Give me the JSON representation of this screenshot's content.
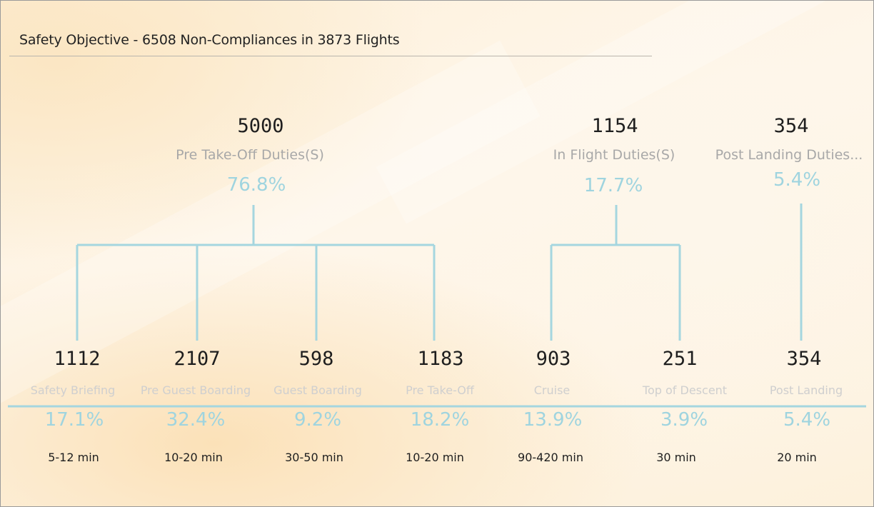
{
  "title": "Safety Objective - 6508 Non-Compliances in 3873 Flights",
  "groups": [
    {
      "value": "5000",
      "label": "Pre Take-Off Duties(S)",
      "percent": "76.8%"
    },
    {
      "value": "1154",
      "label": "In Flight Duties(S)",
      "percent": "17.7%"
    },
    {
      "value": "354",
      "label": "Post Landing Duties...",
      "percent": "5.4%"
    }
  ],
  "phases": [
    {
      "value": "1112",
      "label": "Safety Briefing",
      "percent": "17.1%",
      "duration": "5-12 min"
    },
    {
      "value": "2107",
      "label": "Pre Guest Boarding",
      "percent": "32.4%",
      "duration": "10-20 min"
    },
    {
      "value": "598",
      "label": "Guest Boarding",
      "percent": "9.2%",
      "duration": "30-50 min"
    },
    {
      "value": "1183",
      "label": "Pre Take-Off",
      "percent": "18.2%",
      "duration": "10-20 min"
    },
    {
      "value": "903",
      "label": "Cruise",
      "percent": "13.9%",
      "duration": "90-420 min"
    },
    {
      "value": "251",
      "label": "Top of Descent",
      "percent": "3.9%",
      "duration": "30 min"
    },
    {
      "value": "354",
      "label": "Post Landing",
      "percent": "5.4%",
      "duration": "20 min"
    }
  ],
  "colors": {
    "connector": "#a5d6df",
    "percent": "#9fd4df",
    "background": "#fdf3df"
  }
}
